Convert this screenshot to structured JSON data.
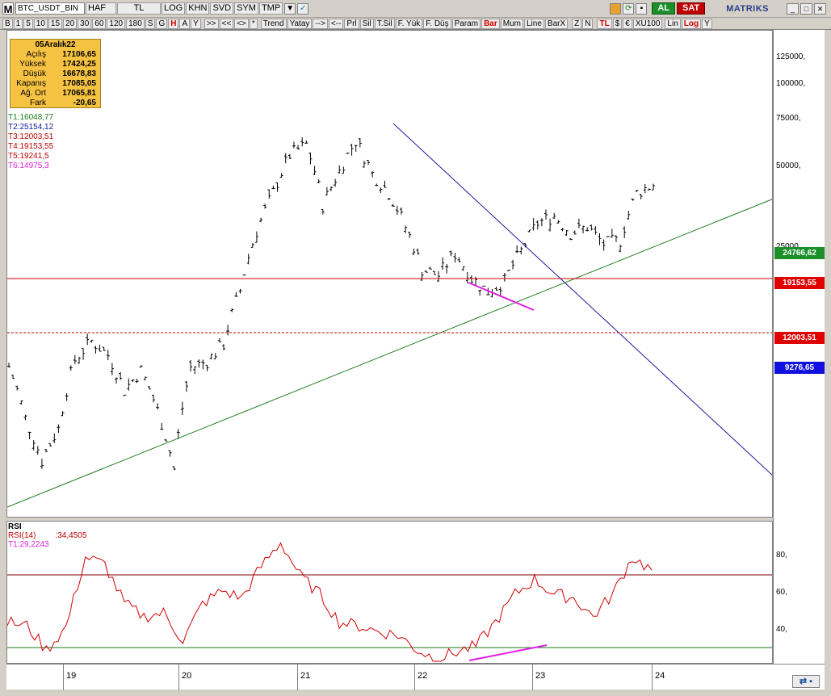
{
  "toolbar1": {
    "app_icon": "M",
    "symbol": "BTC_USDT_BIN",
    "period": "HAF",
    "currency": "TL",
    "buttons": [
      "LOG",
      "KHN",
      "SVD",
      "SYM",
      "TMP"
    ],
    "buy_label": "AL",
    "sell_label": "SAT",
    "brand": "MATRIKS"
  },
  "toolbar2": {
    "left_buttons": [
      "B",
      "1",
      "5",
      "10",
      "15",
      "20",
      "30",
      "60",
      "120",
      "180",
      "S",
      "G",
      "H",
      "A",
      "Y"
    ],
    "nav_buttons": [
      ">>",
      "<<",
      "<>",
      "*"
    ],
    "tool_buttons": [
      "Trend",
      "Yatay",
      "-->",
      "<--",
      "Prl",
      "Sil",
      "T.Sil",
      "F. Yük",
      "F. Düş",
      "Param"
    ],
    "style_buttons": [
      "Bar",
      "Mum",
      "Line",
      "BarX"
    ],
    "right_buttons": [
      "Z",
      "N",
      "TL",
      "$",
      "€",
      "XU100",
      "Lin",
      "Log",
      "Y"
    ]
  },
  "infobox": {
    "date": "05Aralık22",
    "rows": [
      {
        "k": "Açılış",
        "v": "17106,65"
      },
      {
        "k": "Yüksek",
        "v": "17424,25"
      },
      {
        "k": "Düşük",
        "v": "16678,83"
      },
      {
        "k": "Kapanış",
        "v": "17085,05"
      },
      {
        "k": "Ağ. Ort",
        "v": "17065,81"
      },
      {
        "k": "Fark",
        "v": "-20,65"
      }
    ]
  },
  "trendlines": [
    {
      "label": "T1:16048,77",
      "color": "#1a7a1a"
    },
    {
      "label": "T2:25154,12",
      "color": "#1a1aa0"
    },
    {
      "label": "T3:12003,51",
      "color": "#c00000"
    },
    {
      "label": "T4:19153,55",
      "color": "#c00000"
    },
    {
      "label": "T5:19241,5",
      "color": "#c00000"
    },
    {
      "label": "T6:14975,3",
      "color": "#e020e0"
    }
  ],
  "price_axis": {
    "labels": [
      "125000,",
      "100000,",
      "75000,",
      "50000,",
      "25000,"
    ],
    "badges": [
      {
        "value": "24766,62",
        "color": "#1a8f2a"
      },
      {
        "value": "19153,55",
        "color": "#e00000"
      },
      {
        "value": "12003,51",
        "color": "#e00000"
      },
      {
        "value": "9276,65",
        "color": "#1010e0"
      }
    ]
  },
  "rsi": {
    "title": "RSI",
    "line1": "RSI(14)",
    "value1": ":34,4505",
    "line2": "T1:29,2243",
    "axis": [
      "80,",
      "60,",
      "40,"
    ]
  },
  "x_axis": {
    "labels": [
      "19",
      "20",
      "21",
      "22",
      "23",
      "24"
    ]
  },
  "chart_data": {
    "type": "bar",
    "title": "BTC_USDT_BIN",
    "x_labels": [
      "19",
      "20",
      "21",
      "22",
      "23",
      "24"
    ],
    "scale": "log",
    "ohlc_summary": {
      "open": 17106.65,
      "high": 17424.25,
      "low": 16678.83,
      "close": 17085.05
    },
    "close_path": [
      9276,
      6000,
      4200,
      5500,
      9800,
      11500,
      10200,
      7600,
      9000,
      6400,
      3900,
      9200,
      9700,
      11200,
      17600,
      29000,
      40000,
      55000,
      60000,
      36000,
      48000,
      62000,
      47000,
      40000,
      30000,
      21000,
      20000,
      24000,
      19500,
      17400,
      19000,
      24500,
      31000,
      33000,
      28500,
      30000,
      26000,
      26800,
      40000,
      43000
    ],
    "rsi_path": [
      45,
      43,
      30,
      42,
      80,
      76,
      55,
      48,
      50,
      35,
      55,
      62,
      58,
      75,
      88,
      70,
      60,
      45,
      43,
      40,
      38,
      30,
      25,
      29,
      32,
      45,
      60,
      68,
      60,
      58,
      48,
      60,
      80,
      73
    ],
    "rsi_levels": [
      70,
      30
    ]
  }
}
